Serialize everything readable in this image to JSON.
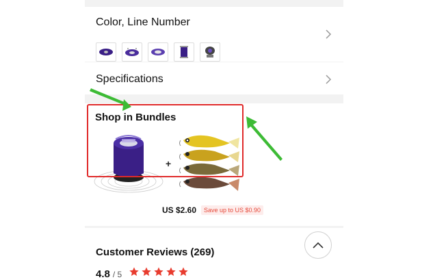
{
  "color_section": {
    "title": "Color, Line Number",
    "thumbnails": [
      "spool-variant-1",
      "spool-variant-2",
      "spool-variant-3",
      "spool-variant-4",
      "spool-variant-5"
    ]
  },
  "specifications": {
    "title": "Specifications"
  },
  "bundle": {
    "title": "Shop in Bundles",
    "plus": "+",
    "price": "US $2.60",
    "save_text": "Save up to US $0.90"
  },
  "reviews": {
    "title": "Customer Reviews (269)",
    "rating": "4.8",
    "rating_max": "/ 5",
    "stars": 5
  },
  "colors": {
    "accent_red": "#e64b3c",
    "star_red": "#e83c2f",
    "highlight_box": "#e02a2a",
    "arrow_green": "#3dbb35",
    "spool_purple": "#3a1f86"
  },
  "icons": {
    "chevron": "chevron-right-icon",
    "back_to_top": "chevron-up-icon"
  }
}
